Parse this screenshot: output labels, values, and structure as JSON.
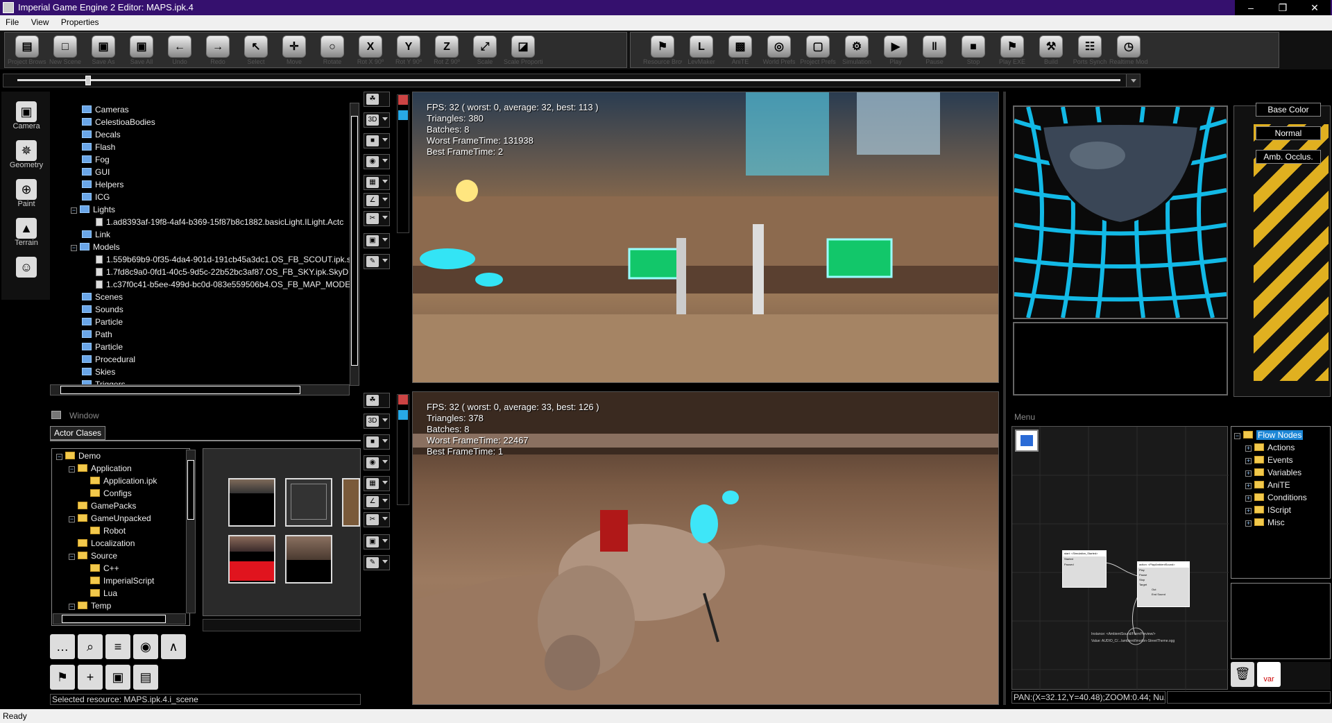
{
  "window": {
    "title": "Imperial Game Engine 2 Editor: MAPS.ipk.4",
    "minimize": "–",
    "restore": "❐",
    "close": "✕"
  },
  "menu": [
    "File",
    "View",
    "Properties"
  ],
  "toolbar": {
    "group1": [
      {
        "label": "Project Browser",
        "icon": "folder-open-icon",
        "glyph": "▤"
      },
      {
        "label": "New Scene",
        "icon": "new-document-icon",
        "glyph": "□"
      },
      {
        "label": "Save As",
        "icon": "save-as-icon",
        "glyph": "▣"
      },
      {
        "label": "Save All",
        "icon": "save-all-icon",
        "glyph": "▣"
      },
      {
        "label": "Undo",
        "icon": "undo-icon",
        "glyph": "←"
      },
      {
        "label": "Redo",
        "icon": "redo-icon",
        "glyph": "→"
      },
      {
        "label": "Select",
        "icon": "select-cursor-icon",
        "glyph": "↖"
      },
      {
        "label": "Move",
        "icon": "move-icon",
        "glyph": "✛"
      },
      {
        "label": "Rotate",
        "icon": "rotate-icon",
        "glyph": "○"
      },
      {
        "label": "Rot X 90º",
        "icon": "rotate-x-icon",
        "glyph": "X"
      },
      {
        "label": "Rot Y 90º",
        "icon": "rotate-y-icon",
        "glyph": "Y"
      },
      {
        "label": "Rot Z 90º",
        "icon": "rotate-z-icon",
        "glyph": "Z"
      },
      {
        "label": "Scale",
        "icon": "scale-icon",
        "glyph": "⤢"
      },
      {
        "label": "Scale Proportional",
        "icon": "scale-proportional-icon",
        "glyph": "◪"
      }
    ],
    "group2": [
      {
        "label": "Resource Browser",
        "icon": "eagle-icon",
        "glyph": "⚑"
      },
      {
        "label": "LevMaker",
        "icon": "levmaker-icon",
        "glyph": "L"
      },
      {
        "label": "AniTE",
        "icon": "clapperboard-icon",
        "glyph": "▩"
      },
      {
        "label": "World Prefs",
        "icon": "globe-icon",
        "glyph": "◎"
      },
      {
        "label": "Project Prefs",
        "icon": "gamepad-icon",
        "glyph": "▢"
      },
      {
        "label": "Simulation",
        "icon": "gear-icon",
        "glyph": "⚙"
      },
      {
        "label": "Play",
        "icon": "play-icon",
        "glyph": "▶"
      },
      {
        "label": "Pause",
        "icon": "pause-icon",
        "glyph": "‖"
      },
      {
        "label": "Stop",
        "icon": "stop-icon",
        "glyph": "■"
      },
      {
        "label": "Play EXE",
        "icon": "play-exe-icon",
        "glyph": "⚑"
      },
      {
        "label": "Build",
        "icon": "build-icon",
        "glyph": "⚒"
      },
      {
        "label": "Ports Synch",
        "icon": "ports-synch-icon",
        "glyph": "☷"
      },
      {
        "label": "Realtime Mode",
        "icon": "stopwatch-icon",
        "glyph": "◷"
      }
    ]
  },
  "side_tools": [
    {
      "label": "Camera",
      "icon": "camera-icon",
      "glyph": "▣"
    },
    {
      "label": "Geometry",
      "icon": "geometry-icon",
      "glyph": "✵"
    },
    {
      "label": "Paint",
      "icon": "paint-icon",
      "glyph": "⊕"
    },
    {
      "label": "Terrain",
      "icon": "terrain-icon",
      "glyph": "▲"
    },
    {
      "label": "",
      "icon": "theater-masks-icon",
      "glyph": "☺"
    }
  ],
  "scene_tree": [
    {
      "label": "Cameras",
      "depth": 0,
      "kind": "folder"
    },
    {
      "label": "CelestioaBodies",
      "depth": 0,
      "kind": "folder"
    },
    {
      "label": "Decals",
      "depth": 0,
      "kind": "folder"
    },
    {
      "label": "Flash",
      "depth": 0,
      "kind": "folder"
    },
    {
      "label": "Fog",
      "depth": 0,
      "kind": "folder"
    },
    {
      "label": "GUI",
      "depth": 0,
      "kind": "folder"
    },
    {
      "label": "Helpers",
      "depth": 0,
      "kind": "folder"
    },
    {
      "label": "ICG",
      "depth": 0,
      "kind": "folder"
    },
    {
      "label": "Lights",
      "depth": 0,
      "kind": "folder",
      "expanded": true
    },
    {
      "label": "1.ad8393af-19f8-4af4-b369-15f87b8c1882.basicLight.ILight.Actc",
      "depth": 1,
      "kind": "file"
    },
    {
      "label": "Link",
      "depth": 0,
      "kind": "folder"
    },
    {
      "label": "Models",
      "depth": 0,
      "kind": "folder",
      "expanded": true
    },
    {
      "label": "1.559b69b9-0f35-4da4-901d-191cb45a3dc1.OS_FB_SCOUT.ipk.s",
      "depth": 1,
      "kind": "file"
    },
    {
      "label": "1.7fd8c9a0-0fd1-40c5-9d5c-22b52bc3af87.OS_FB_SKY.ipk.SkyD",
      "depth": 1,
      "kind": "file"
    },
    {
      "label": "1.c37f0c41-b5ee-499d-bc0d-083e559506b4.OS_FB_MAP_MODE",
      "depth": 1,
      "kind": "file"
    },
    {
      "label": "Scenes",
      "depth": 0,
      "kind": "folder"
    },
    {
      "label": "Sounds",
      "depth": 0,
      "kind": "folder"
    },
    {
      "label": "Particle",
      "depth": 0,
      "kind": "folder"
    },
    {
      "label": "Path",
      "depth": 0,
      "kind": "folder"
    },
    {
      "label": "Particle",
      "depth": 0,
      "kind": "folder"
    },
    {
      "label": "Procedural",
      "depth": 0,
      "kind": "folder"
    },
    {
      "label": "Skies",
      "depth": 0,
      "kind": "folder"
    },
    {
      "label": "Triggers",
      "depth": 0,
      "kind": "folder"
    }
  ],
  "window_panel": {
    "title": "Window",
    "tab": "Actor Clases"
  },
  "actor_tree": [
    {
      "label": "Demo",
      "depth": 0,
      "exp": "−"
    },
    {
      "label": "Application",
      "depth": 1,
      "exp": "−"
    },
    {
      "label": "Application.ipk",
      "depth": 2,
      "exp": ""
    },
    {
      "label": "Configs",
      "depth": 2,
      "exp": ""
    },
    {
      "label": "GamePacks",
      "depth": 1,
      "exp": ""
    },
    {
      "label": "GameUnpacked",
      "depth": 1,
      "exp": "−"
    },
    {
      "label": "Robot",
      "depth": 2,
      "exp": ""
    },
    {
      "label": "Localization",
      "depth": 1,
      "exp": ""
    },
    {
      "label": "Source",
      "depth": 1,
      "exp": "−"
    },
    {
      "label": "C++",
      "depth": 2,
      "exp": ""
    },
    {
      "label": "ImperialScript",
      "depth": 2,
      "exp": ""
    },
    {
      "label": "Lua",
      "depth": 2,
      "exp": ""
    },
    {
      "label": "Temp",
      "depth": 1,
      "exp": "−"
    }
  ],
  "bottom_tools": [
    {
      "icon": "chat-bubble-icon",
      "glyph": "…"
    },
    {
      "icon": "magnifier-icon",
      "glyph": "⌕"
    },
    {
      "icon": "notes-icon",
      "glyph": "≡"
    },
    {
      "icon": "film-reel-icon",
      "glyph": "◉"
    },
    {
      "icon": "wave-logo-icon",
      "glyph": "∧"
    },
    {
      "icon": "eagle-icon",
      "glyph": "⚑"
    },
    {
      "icon": "add-green-icon",
      "glyph": "+"
    },
    {
      "icon": "frame-icon",
      "glyph": "▣"
    },
    {
      "icon": "window-layout-icon",
      "glyph": "▤"
    }
  ],
  "selected_resource": "Selected resource: MAPS.ipk.4.i_scene",
  "status": "Ready",
  "viewport_top": {
    "fps": "FPS:  32  (  worst:  0,  average:  32,  best:  113  )",
    "triangles": "Triangles:  380",
    "batches": "Batches:  8",
    "worst_frame": "Worst  FrameTime:  131938",
    "best_frame": "Best  FrameTime:  2"
  },
  "viewport_bottom": {
    "fps": "FPS:  32  (  worst:  0,  average:  33,  best:  126  )",
    "triangles": "Triangles:  378",
    "batches": "Batches:  8",
    "worst_frame": "Worst  FrameTime:  22467",
    "best_frame": "Best  FrameTime:  1"
  },
  "material_buttons": [
    "Base Color",
    "Normal",
    "Amb. Occlus."
  ],
  "menu_panel": {
    "title": "Menu",
    "pan_status": "PAN:(X=32.12,Y=40.48);ZOOM:0.44; Nu..."
  },
  "flow_tree": [
    "Flow Nodes",
    "Actions",
    "Events",
    "Variables",
    "AniTE",
    "Conditions",
    "IScript",
    "Misc"
  ],
  "node_graph": {
    "node1_title": "start: <Simulation_Started>",
    "node1_rows": [
      "Started",
      "Paused"
    ],
    "node2_title": "action: <PlayAmbientSound>",
    "node2_rows": [
      "Play",
      "Pause",
      "Stop",
      "Target",
      "Out",
      "End Sound"
    ],
    "instance_line1": "Instance: <AmbientSound/FromPreview/>",
    "instance_line2": "Value:  AUDIO_C/.../ambient/Imodon-StreetTheme.ogg"
  },
  "colors": {
    "titlebar": "#35106e",
    "accent_cyan": "#12b9e6",
    "flow_selected": "#1c86d6"
  }
}
